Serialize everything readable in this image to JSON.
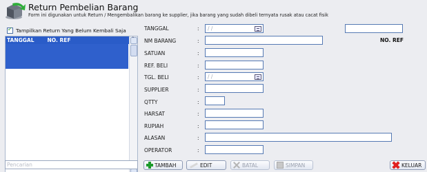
{
  "header": {
    "title": "Return Pembelian Barang",
    "subtitle": "Form ini digunakan untuk Return / Mengembalikan barang ke supplier, jika barang yang sudah dibeli ternyata rusak atau cacat fisik"
  },
  "left": {
    "checkbox_label": "Tampilkan Return Yang Belum Kembali Saja",
    "checkbox_checked": true,
    "columns": [
      "TANGGAL",
      "NO. REF"
    ],
    "search_placeholder": "Pencarian"
  },
  "form": {
    "tanggal_label": "TANGGAL",
    "tanggal_value": " /  /",
    "nm_barang_label": "NM BARANG",
    "satuan_label": "SATUAN",
    "ref_beli_label": "REF. BELI",
    "tgl_beli_label": "TGL. BELI",
    "tgl_beli_value": " /  /",
    "supplier_label": "SUPPLIER",
    "qtty_label": "QTTY",
    "harsat_label": "HARSAT",
    "rupiah_label": "RUPIAH",
    "alasan_label": "ALASAN",
    "operator_label": "OPERATOR",
    "colon": ":",
    "no_ref_label": "NO. REF"
  },
  "buttons": {
    "tambah": "TAMBAH",
    "edit": "EDIT",
    "batal": "BATAL",
    "simpan": "SIMPAN",
    "keluar": "KELUAR"
  },
  "colors": {
    "background": "#ecedf1",
    "grid_header": "#2a5cc8",
    "field_border": "#5579b3"
  }
}
